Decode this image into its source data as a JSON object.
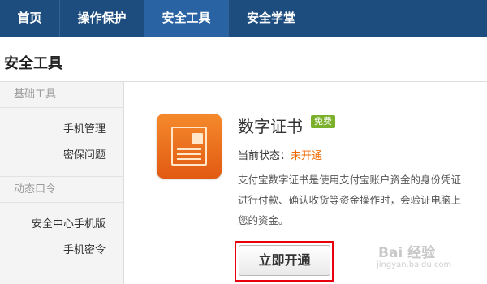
{
  "nav": {
    "items": [
      {
        "label": "首页"
      },
      {
        "label": "操作保护"
      },
      {
        "label": "安全工具"
      },
      {
        "label": "安全学堂"
      }
    ],
    "active_index": 2
  },
  "page": {
    "title": "安全工具"
  },
  "sidebar": {
    "groups": [
      {
        "header": "基础工具",
        "items": [
          "手机管理",
          "密保问题"
        ]
      },
      {
        "header": "动态口令",
        "items": [
          "安全中心手机版",
          "手机密令"
        ]
      }
    ]
  },
  "tool": {
    "icon": "certificate-icon",
    "name": "数字证书",
    "badge": "免费",
    "status_label": "当前状态：",
    "status_value": "未开通",
    "description_lines": [
      "支付宝数字证书是使用支付宝账户资金的身份凭证",
      "进行付款、确认收货等资金操作时，会验证电脑上",
      "您的资金。"
    ],
    "activate_label": "立即开通"
  },
  "watermark": {
    "logo": "Bai 经验",
    "url": "jingyan.baidu.com"
  },
  "colors": {
    "nav_bg": "#1d4d7f",
    "nav_active": "#2a63a3",
    "status_orange": "#f26a00",
    "badge_green": "#7ab02c",
    "highlight_red": "#e8000f",
    "icon_orange": "#f07a22"
  }
}
